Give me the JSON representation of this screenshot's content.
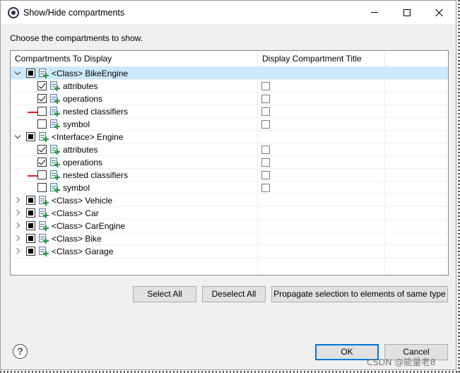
{
  "window": {
    "title": "Show/Hide compartments",
    "controls": {
      "minimize": "minimize-icon",
      "maximize": "maximize-icon",
      "close": "close-icon"
    }
  },
  "instruction": "Choose the compartments to show.",
  "table": {
    "columns": [
      "Compartments To Display",
      "Display Compartment Title"
    ],
    "rows": [
      {
        "label": "<Class> BikeEngine",
        "level": 0,
        "expander": "open",
        "state": "partial",
        "icon": "class-icon",
        "selected": true,
        "title_checkbox": false
      },
      {
        "label": "attributes",
        "level": 1,
        "state": "checked",
        "icon": "class-icon",
        "title_checkbox": true
      },
      {
        "label": "operations",
        "level": 1,
        "state": "checked",
        "icon": "class-icon",
        "title_checkbox": true
      },
      {
        "label": "nested classifiers",
        "level": 1,
        "state": "unchecked",
        "icon": "class-icon",
        "title_checkbox": true,
        "red_mark": true
      },
      {
        "label": "symbol",
        "level": 1,
        "state": "unchecked",
        "icon": "class-icon",
        "title_checkbox": true
      },
      {
        "label": "<Interface> Engine",
        "level": 0,
        "expander": "open",
        "state": "partial",
        "icon": "interface-icon",
        "title_checkbox": false
      },
      {
        "label": "attributes",
        "level": 1,
        "state": "checked",
        "icon": "interface-icon",
        "title_checkbox": true
      },
      {
        "label": "operations",
        "level": 1,
        "state": "checked",
        "icon": "interface-icon",
        "title_checkbox": true
      },
      {
        "label": "nested classifiers",
        "level": 1,
        "state": "unchecked",
        "icon": "interface-icon",
        "title_checkbox": true,
        "red_mark": true
      },
      {
        "label": "symbol",
        "level": 1,
        "state": "unchecked",
        "icon": "interface-icon",
        "title_checkbox": true
      },
      {
        "label": "<Class> Vehicle",
        "level": 0,
        "expander": "closed",
        "state": "partial",
        "icon": "class-icon",
        "title_checkbox": false
      },
      {
        "label": "<Class> Car",
        "level": 0,
        "expander": "closed",
        "state": "partial",
        "icon": "class-icon",
        "title_checkbox": false
      },
      {
        "label": "<Class> CarEngine",
        "level": 0,
        "expander": "closed",
        "state": "partial",
        "icon": "class-icon",
        "title_checkbox": false
      },
      {
        "label": "<Class> Bike",
        "level": 0,
        "expander": "closed",
        "state": "partial",
        "icon": "class-icon",
        "title_checkbox": false
      },
      {
        "label": "<Class> Garage",
        "level": 0,
        "expander": "closed",
        "state": "partial",
        "icon": "class-icon",
        "title_checkbox": false
      }
    ]
  },
  "buttons": {
    "select_all": "Select All",
    "deselect_all": "Deselect All",
    "propagate": "Propagate selection to elements of same type",
    "ok": "OK",
    "cancel": "Cancel"
  },
  "help": {
    "icon": "help-icon",
    "glyph": "?"
  },
  "watermark": "CSDN @能量老8",
  "colors": {
    "selection": "#cce8ff",
    "accent": "#0078d7",
    "mark": "#e02020"
  }
}
